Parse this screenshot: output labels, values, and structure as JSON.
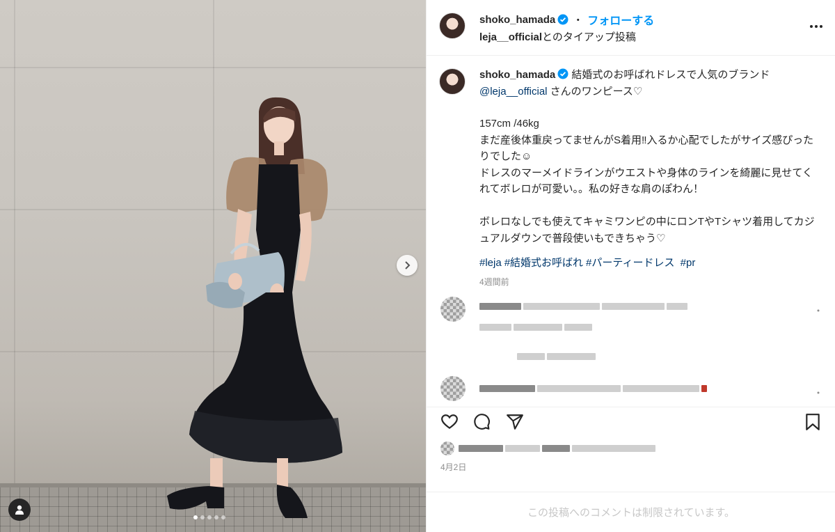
{
  "header": {
    "username": "shoko_hamada",
    "separator": "・",
    "follow_label": "フォローする",
    "partner_name": "leja__official",
    "partner_suffix": "とのタイアップ投稿",
    "more_icon": "more-horizontal-icon"
  },
  "caption": {
    "username": "shoko_hamada",
    "line1": "結婚式のお呼ばれドレスで人気のブランド",
    "mention": "@leja__official",
    "line2_rest": " さんのワンピース♡",
    "body": "157cm /46kg\nまだ産後体重戻ってませんがS着用‼入るか心配でしたがサイズ感ぴったりでした☺︎\nドレスのマーメイドラインがウエストや身体のラインを綺麗に見せてくれてボレロが可愛い。。私の好きな肩のぽわん！\n\nボレロなしでも使えてキャミワンピの中にロンTやTシャツ着用してカジュアルダウンで普段使いもできちゃう♡",
    "hashtags": [
      "#leja",
      "#結婚式お呼ばれ",
      "#パーティードレス",
      " #pr"
    ],
    "time_ago": "4週間前"
  },
  "actions": {
    "like_icon": "heart-icon",
    "comment_icon": "comment-icon",
    "share_icon": "share-icon",
    "save_icon": "bookmark-icon"
  },
  "date": "4月2日",
  "footer_text": "この投稿へのコメントは制限されています。",
  "carousel": {
    "total": 5,
    "active_index": 0
  },
  "colors": {
    "accent": "#0095f6",
    "link": "#00376b",
    "muted": "#8e8e8e"
  }
}
